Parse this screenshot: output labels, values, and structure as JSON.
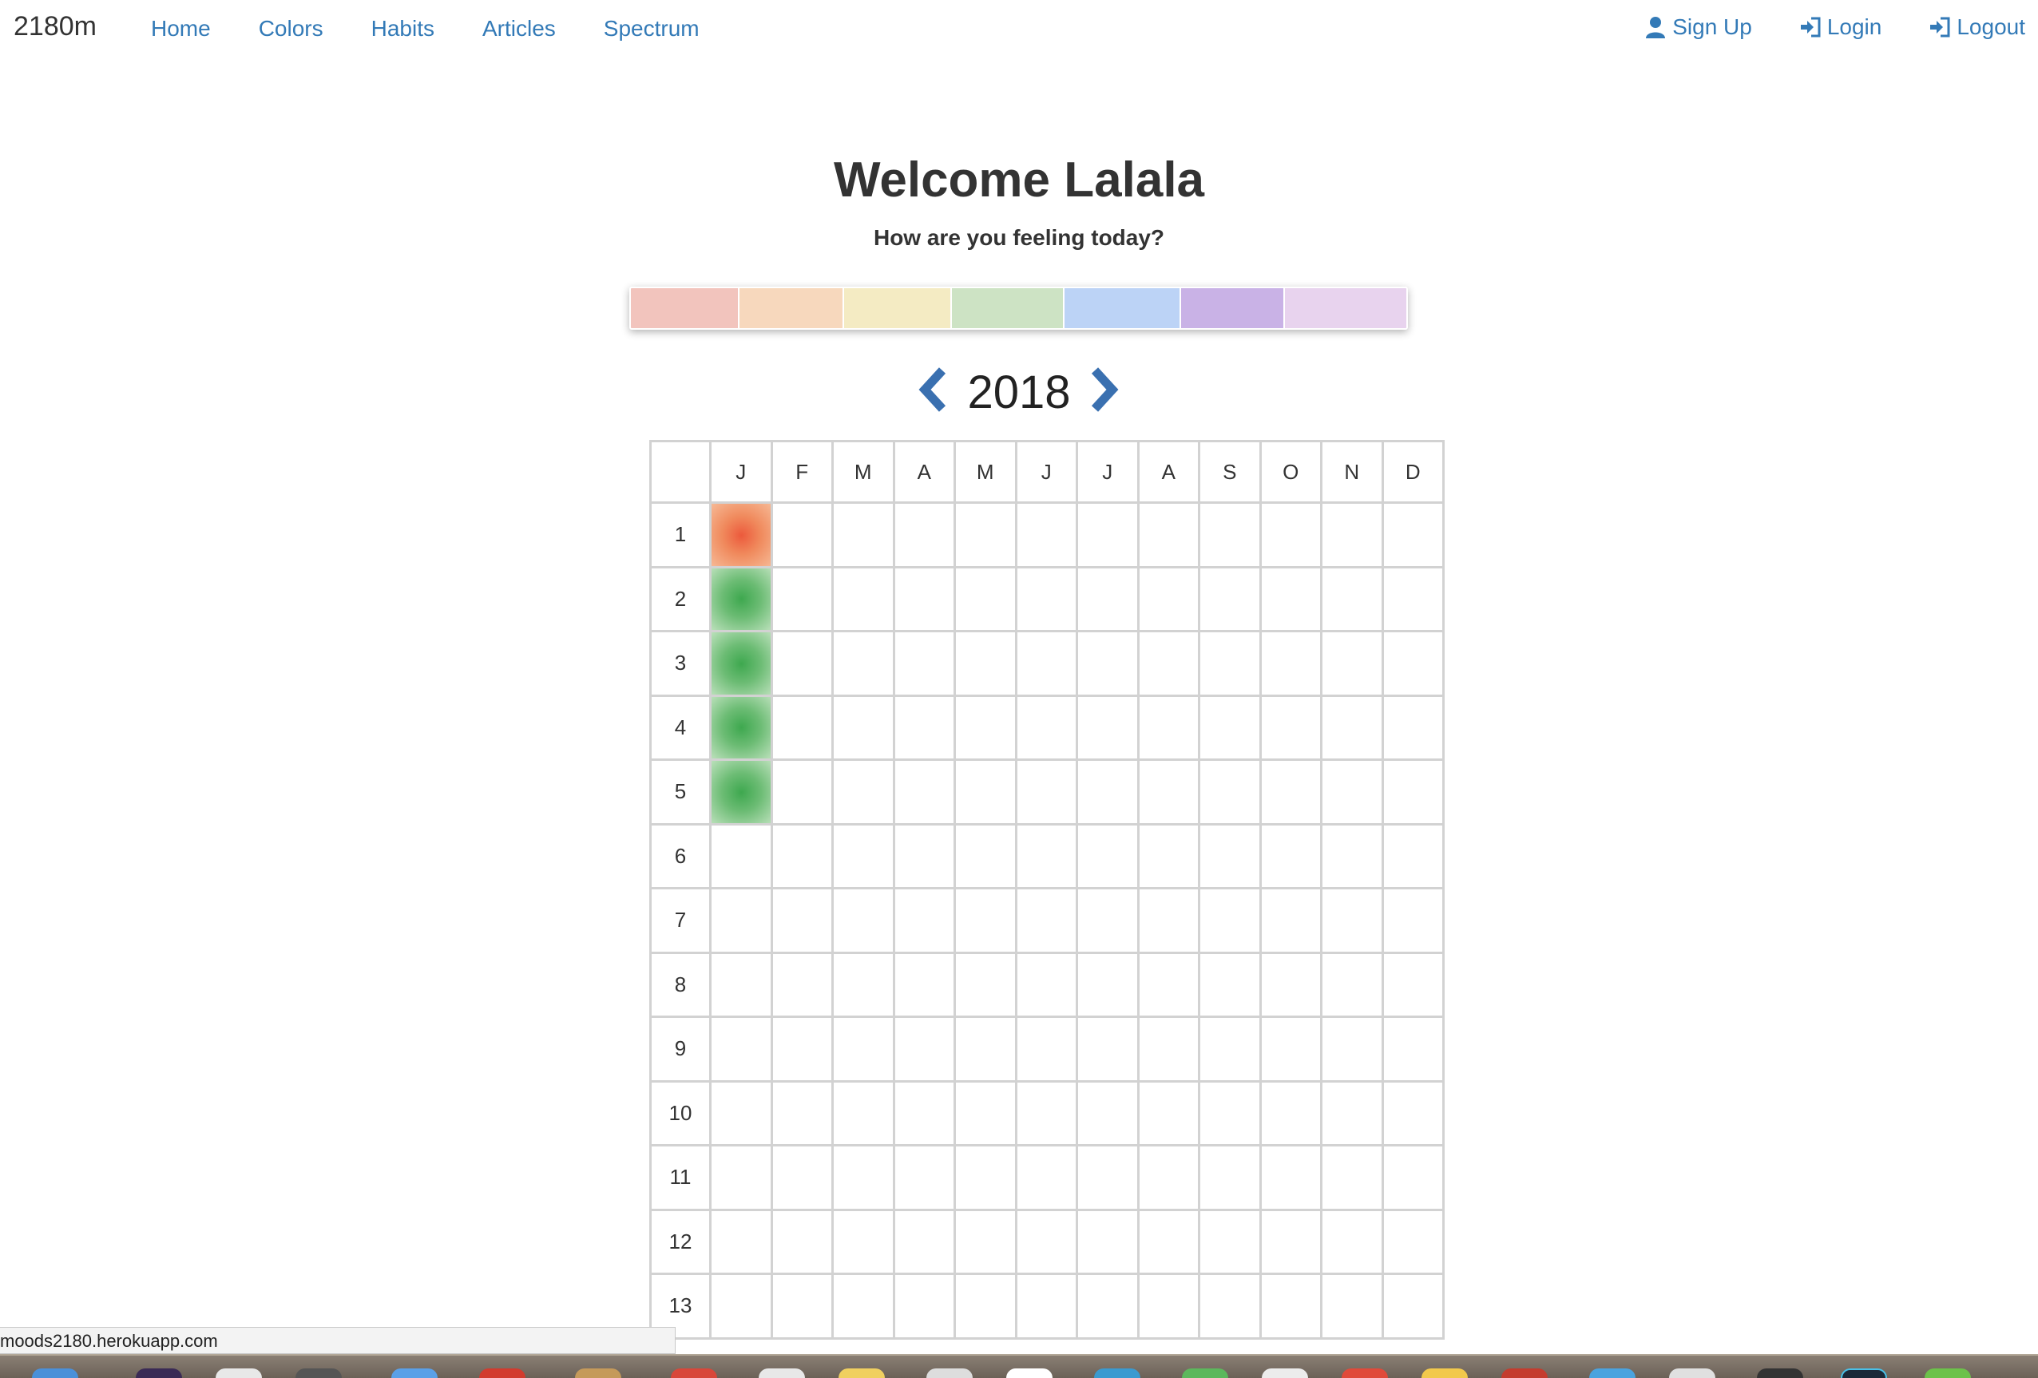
{
  "navbar": {
    "brand": "2180m",
    "links": [
      "Home",
      "Colors",
      "Habits",
      "Articles",
      "Spectrum"
    ],
    "right_links": [
      {
        "label": "Sign Up",
        "icon": "user-icon"
      },
      {
        "label": "Login",
        "icon": "login-icon"
      },
      {
        "label": "Logout",
        "icon": "logout-icon"
      }
    ]
  },
  "header": {
    "title": "Welcome Lalala",
    "subtitle": "How are you feeling today?"
  },
  "mood_palette": [
    {
      "color": "#f2c4bd"
    },
    {
      "color": "#f7d8bd"
    },
    {
      "color": "#f4ebc3"
    },
    {
      "color": "#cde3c4"
    },
    {
      "color": "#bcd3f6"
    },
    {
      "color": "#c9b2e6"
    },
    {
      "color": "#e8d3ee"
    }
  ],
  "calendar": {
    "year": "2018",
    "prev_icon": "chevron-left-icon",
    "next_icon": "chevron-right-icon",
    "months": [
      "J",
      "F",
      "M",
      "A",
      "M",
      "J",
      "J",
      "A",
      "S",
      "O",
      "N",
      "D"
    ],
    "days": [
      "1",
      "2",
      "3",
      "4",
      "5",
      "6",
      "7",
      "8",
      "9",
      "10",
      "11",
      "12",
      "13"
    ],
    "entries": [
      {
        "month": "J",
        "day": "1",
        "mood": "orange",
        "color": "#ec5a3c"
      },
      {
        "month": "J",
        "day": "2",
        "mood": "green",
        "color": "#3ea84f"
      },
      {
        "month": "J",
        "day": "3",
        "mood": "green",
        "color": "#3ea84f"
      },
      {
        "month": "J",
        "day": "4",
        "mood": "green",
        "color": "#3ea84f"
      },
      {
        "month": "J",
        "day": "5",
        "mood": "green",
        "color": "#3ea84f"
      }
    ]
  },
  "status_bar": {
    "url": "moods2180.herokuapp.com"
  },
  "colors": {
    "link": "#337ab7",
    "text": "#333333",
    "grid_border": "#d2d2d2"
  }
}
